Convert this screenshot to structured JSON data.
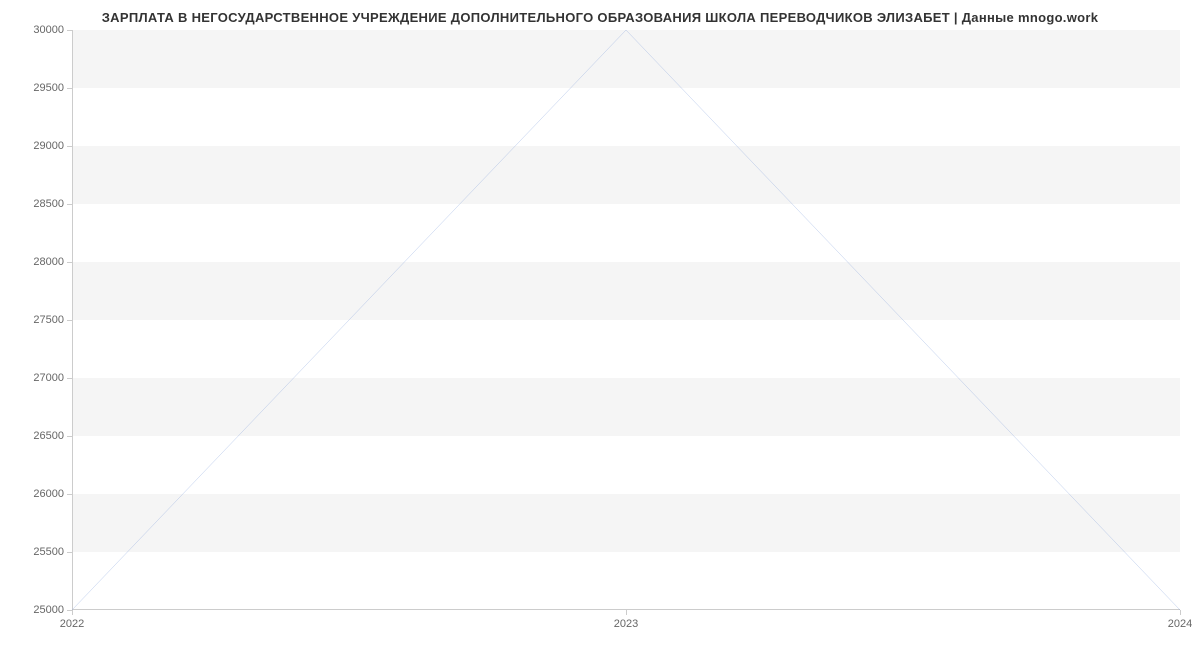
{
  "chart_data": {
    "type": "line",
    "title": "ЗАРПЛАТА В НЕГОСУДАРСТВЕННОЕ УЧРЕЖДЕНИЕ ДОПОЛНИТЕЛЬНОГО ОБРАЗОВАНИЯ ШКОЛА ПЕРЕВОДЧИКОВ ЭЛИЗАБЕТ | Данные mnogo.work",
    "xlabel": "",
    "ylabel": "",
    "x_categories": [
      "2022",
      "2023",
      "2024"
    ],
    "y_ticks": [
      25000,
      25500,
      26000,
      26500,
      27000,
      27500,
      28000,
      28500,
      29000,
      29500,
      30000
    ],
    "ylim": [
      25000,
      30000
    ],
    "series": [
      {
        "name": "salary",
        "color": "#6b8fd4",
        "values": [
          25000,
          30000,
          25000
        ]
      }
    ]
  }
}
